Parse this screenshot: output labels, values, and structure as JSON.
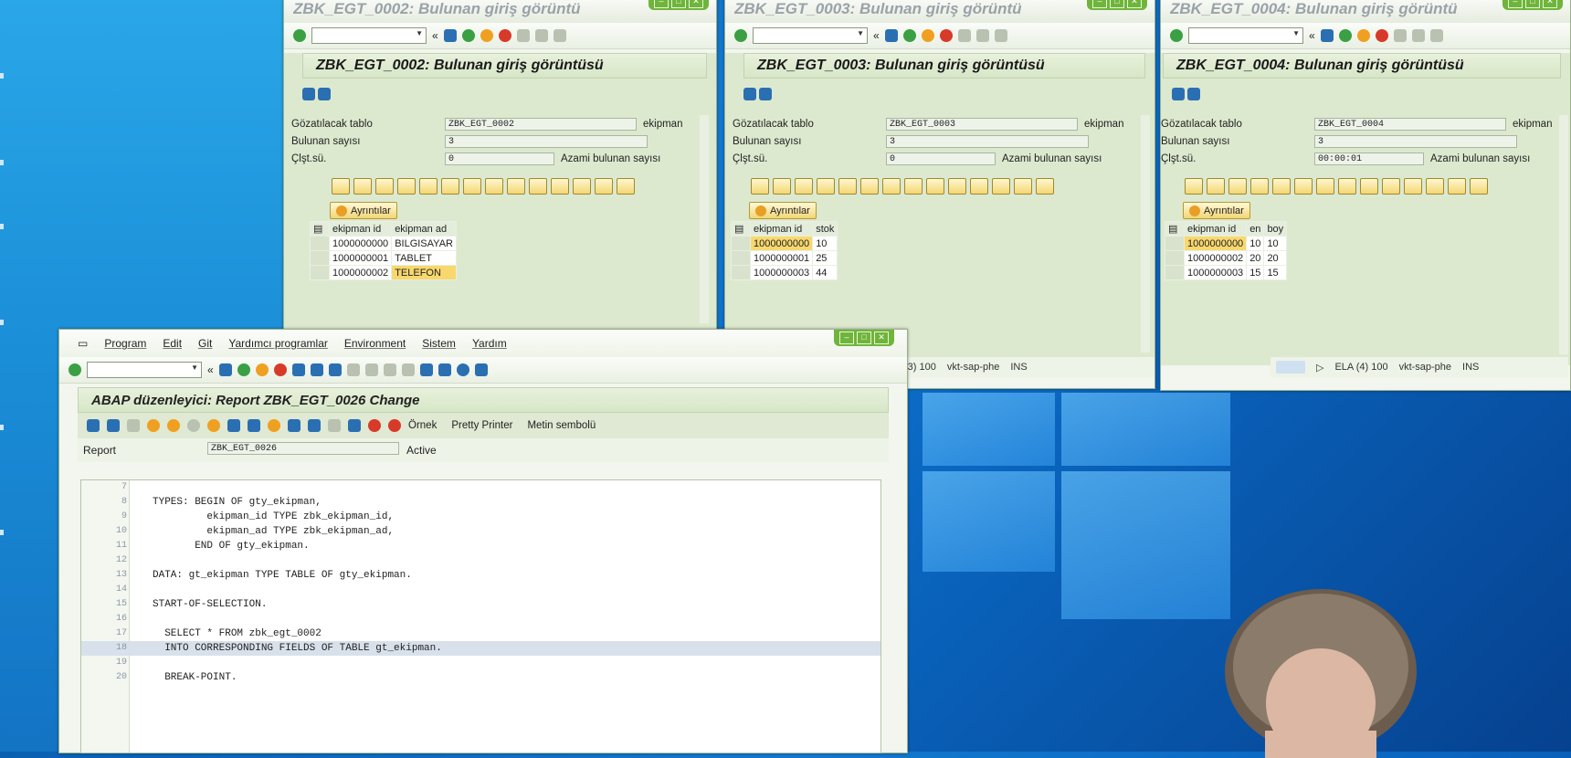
{
  "desktop": {
    "color_accent": "#1379cf"
  },
  "win2": {
    "title": "ZBK_EGT_0002: Bulunan giriş görüntü",
    "header": "ZBK_EGT_0002: Bulunan giriş görüntüsü",
    "f1_label": "Gözatılacak tablo",
    "f1_value": "ZBK_EGT_0002",
    "f1_trail": "ekipman",
    "f2_label": "Bulunan sayısı",
    "f2_value": "3",
    "f3_label": "Çlşt.sü.",
    "f3_value": "0",
    "f3_trail": "Azami bulunan sayısı",
    "details": "Ayrıntılar",
    "cols": [
      "ekipman id",
      "ekipman ad"
    ],
    "rows": [
      [
        "1000000000",
        "BILGISAYAR"
      ],
      [
        "1000000001",
        "TABLET"
      ],
      [
        "1000000002",
        "TELEFON"
      ]
    ]
  },
  "win3": {
    "title": "ZBK_EGT_0003: Bulunan giriş görüntü",
    "header": "ZBK_EGT_0003: Bulunan giriş görüntüsü",
    "f1_label": "Gözatılacak tablo",
    "f1_value": "ZBK_EGT_0003",
    "f1_trail": "ekipman",
    "f2_label": "Bulunan sayısı",
    "f2_value": "3",
    "f3_label": "Çlşt.sü.",
    "f3_value": "0",
    "f3_trail": "Azami bulunan sayısı",
    "details": "Ayrıntılar",
    "cols": [
      "ekipman id",
      "stok"
    ],
    "rows": [
      [
        "1000000000",
        "10"
      ],
      [
        "1000000001",
        "25"
      ],
      [
        "1000000003",
        "44"
      ]
    ],
    "status": [
      "(3) 100",
      "vkt-sap-phe",
      "INS"
    ]
  },
  "win4": {
    "title": "ZBK_EGT_0004: Bulunan giriş görüntü",
    "header": "ZBK_EGT_0004: Bulunan giriş görüntüsü",
    "f1_label": "Gözatılacak tablo",
    "f1_value": "ZBK_EGT_0004",
    "f1_trail": "ekipman",
    "f2_label": "Bulunan sayısı",
    "f2_value": "3",
    "f3_label": "Çlşt.sü.",
    "f3_value": "00:00:01",
    "f3_trail": "Azami bulunan sayısı",
    "details": "Ayrıntılar",
    "cols": [
      "ekipman id",
      "en",
      "boy"
    ],
    "rows": [
      [
        "1000000000",
        "10",
        "10"
      ],
      [
        "1000000002",
        "20",
        "20"
      ],
      [
        "1000000003",
        "15",
        "15"
      ]
    ],
    "status": [
      "ELA (4) 100",
      "vkt-sap-phe",
      "INS"
    ]
  },
  "editor": {
    "menu": [
      "Program",
      "Edit",
      "Git",
      "Yardımcı programlar",
      "Environment",
      "Sistem",
      "Yardım"
    ],
    "header": "ABAP düzenleyici: Report ZBK_EGT_0026 Change",
    "app_buttons": [
      "Örnek",
      "Pretty Printer",
      "Metin sembolü"
    ],
    "report_label": "Report",
    "report_value": "ZBK_EGT_0026",
    "report_status": "Active",
    "lines": [
      {
        "n": "7",
        "t": ""
      },
      {
        "n": "8",
        "t": "TYPES: BEGIN OF gty_ekipman,"
      },
      {
        "n": "9",
        "t": "         ekipman_id TYPE zbk_ekipman_id,"
      },
      {
        "n": "10",
        "t": "         ekipman_ad TYPE zbk_ekipman_ad,"
      },
      {
        "n": "11",
        "t": "       END OF gty_ekipman."
      },
      {
        "n": "12",
        "t": ""
      },
      {
        "n": "13",
        "t": "DATA: gt_ekipman TYPE TABLE OF gty_ekipman."
      },
      {
        "n": "14",
        "t": ""
      },
      {
        "n": "15",
        "t": "START-OF-SELECTION."
      },
      {
        "n": "16",
        "t": ""
      },
      {
        "n": "17",
        "t": "  SELECT * FROM zbk_egt_0002"
      },
      {
        "n": "18",
        "t": "  INTO CORRESPONDING FIELDS OF TABLE gt_ekipman."
      },
      {
        "n": "19",
        "t": ""
      },
      {
        "n": "20",
        "t": "  BREAK-POINT."
      }
    ]
  }
}
